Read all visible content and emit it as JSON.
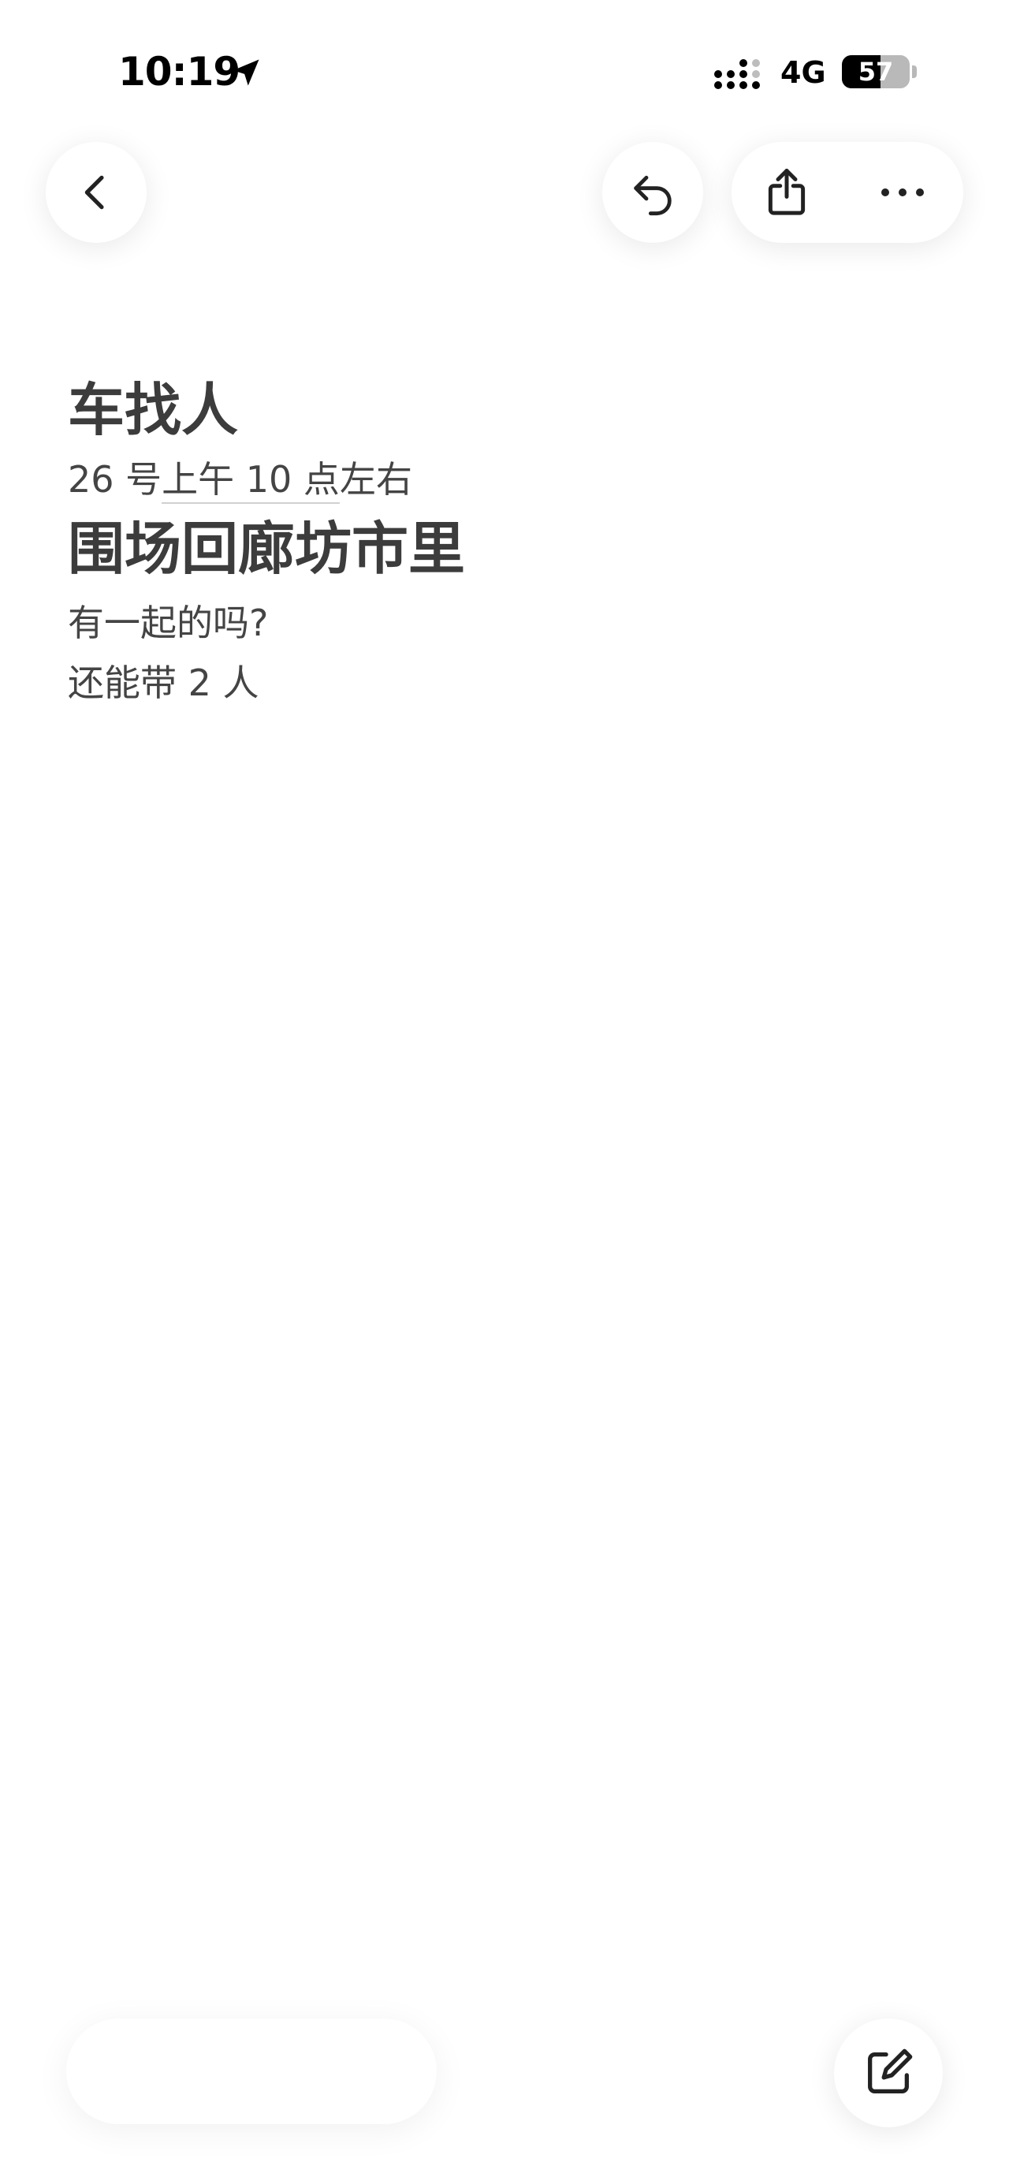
{
  "status_bar": {
    "time": "10:19",
    "network": "4G",
    "battery_level": "57",
    "battery_fraction": 0.57
  },
  "icons": {
    "location": "location-arrow-icon",
    "signal": "cellular-signal-icon",
    "back": "chevron-left-icon",
    "undo": "undo-icon",
    "share": "share-icon",
    "more": "ellipsis-icon",
    "compose": "compose-icon"
  },
  "note": {
    "title": "车找人",
    "line1_prefix": "26 号",
    "line1_underlined": "上午 10 点",
    "line1_suffix": "左右",
    "heading": "围场回廊坊市里",
    "line2": "有一起的吗?",
    "line3": "还能带 2 人"
  }
}
